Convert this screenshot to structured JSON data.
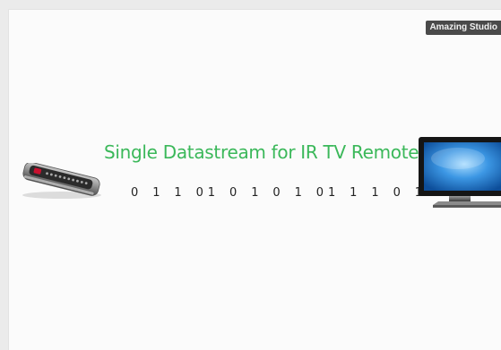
{
  "watermark": {
    "text": "Amazing Studio"
  },
  "diagram": {
    "title": "Single Datastream for IR TV Remotes",
    "bitstream": "0 1 1 01 0 1 0 1 01 1 1 0 1 1 1",
    "icons": {
      "remote": "remote-control-icon",
      "tv": "television-icon"
    },
    "colors": {
      "title": "#3bb85a",
      "screen": "#1e77c9",
      "background": "#fbfbfb"
    }
  }
}
